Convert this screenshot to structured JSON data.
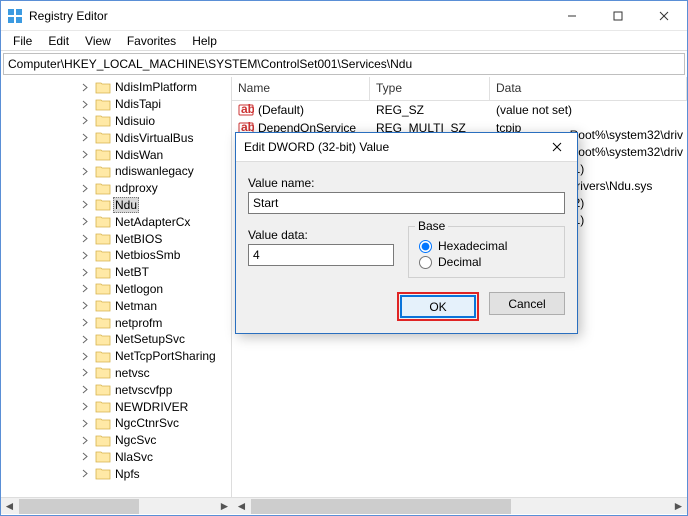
{
  "window": {
    "title": "Registry Editor"
  },
  "menu": {
    "file": "File",
    "edit": "Edit",
    "view": "View",
    "favorites": "Favorites",
    "help": "Help"
  },
  "address": "Computer\\HKEY_LOCAL_MACHINE\\SYSTEM\\ControlSet001\\Services\\Ndu",
  "tree": {
    "items": [
      {
        "label": "NdisImPlatform",
        "exp": true
      },
      {
        "label": "NdisTapi",
        "exp": true
      },
      {
        "label": "Ndisuio",
        "exp": true
      },
      {
        "label": "NdisVirtualBus",
        "exp": true
      },
      {
        "label": "NdisWan",
        "exp": true
      },
      {
        "label": "ndiswanlegacy",
        "exp": true
      },
      {
        "label": "ndproxy",
        "exp": false
      },
      {
        "label": "Ndu",
        "exp": false,
        "selected": true
      },
      {
        "label": "NetAdapterCx",
        "exp": false
      },
      {
        "label": "NetBIOS",
        "exp": true
      },
      {
        "label": "NetbiosSmb",
        "exp": false
      },
      {
        "label": "NetBT",
        "exp": true
      },
      {
        "label": "Netlogon",
        "exp": true
      },
      {
        "label": "Netman",
        "exp": false
      },
      {
        "label": "netprofm",
        "exp": false
      },
      {
        "label": "NetSetupSvc",
        "exp": false
      },
      {
        "label": "NetTcpPortSharing",
        "exp": true
      },
      {
        "label": "netvsc",
        "exp": false
      },
      {
        "label": "netvscvfpp",
        "exp": false
      },
      {
        "label": "NEWDRIVER",
        "exp": false
      },
      {
        "label": "NgcCtnrSvc",
        "exp": true
      },
      {
        "label": "NgcSvc",
        "exp": true
      },
      {
        "label": "NlaSvc",
        "exp": true
      },
      {
        "label": "Npfs",
        "exp": false
      }
    ]
  },
  "list": {
    "cols": {
      "name": "Name",
      "type": "Type",
      "data": "Data"
    },
    "rows": [
      {
        "name": "(Default)",
        "type": "REG_SZ",
        "data": "(value not set)"
      },
      {
        "name": "DependOnService",
        "type": "REG_MULTI_SZ",
        "data": "tcpip"
      }
    ],
    "hidden_data": [
      "Root%\\system32\\driv",
      "Root%\\system32\\driv",
      "(1)",
      "drivers\\Ndu.sys",
      "(2)",
      "(1)"
    ]
  },
  "dialog": {
    "title": "Edit DWORD (32-bit) Value",
    "value_name_lbl": "Value name:",
    "value_name": "Start",
    "value_data_lbl": "Value data:",
    "value_data": "4",
    "base_lbl": "Base",
    "hex": "Hexadecimal",
    "dec": "Decimal",
    "ok": "OK",
    "cancel": "Cancel"
  }
}
